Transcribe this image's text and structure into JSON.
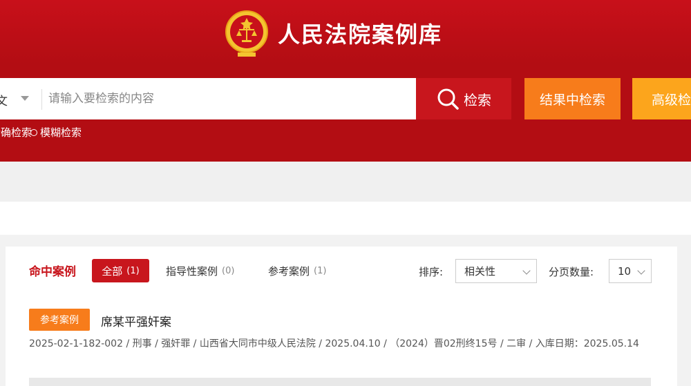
{
  "header": {
    "site_title": "人民法院案例库",
    "colors": {
      "header_red": "#b30d13",
      "search_red": "#c8161d",
      "refine_orange": "#f77c1b",
      "advanced_orange": "#fca51c"
    }
  },
  "search": {
    "scope_value": "文",
    "placeholder": "请输入要检索的内容",
    "search_button": "检索",
    "refine_button": "结果中检索",
    "advanced_button": "高级检索",
    "mode_exact": "精确检索",
    "mode_fuzzy": "模糊检索"
  },
  "results": {
    "hit_label": "命中案例",
    "tabs": [
      {
        "label": "全部",
        "count": "(1)",
        "active": true
      },
      {
        "label": "指导性案例",
        "count": "(0)",
        "active": false
      },
      {
        "label": "参考案例",
        "count": "(1)",
        "active": false
      }
    ],
    "sort_label": "排序:",
    "sort_value": "相关性",
    "page_size_label": "分页数量:",
    "page_size_value": "10",
    "cases": [
      {
        "badge": "参考案例",
        "title": "席某平强奸案",
        "meta": "2025-02-1-182-002 / 刑事 / 强奸罪 / 山西省大同市中级人民法院 / 2025.04.10 / （2024）晋02刑终15号 / 二审 / 入库日期：2025.05.14"
      }
    ]
  }
}
